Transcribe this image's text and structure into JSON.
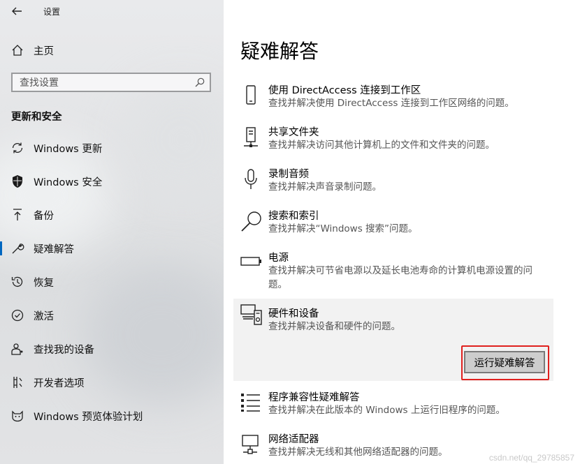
{
  "window": {
    "title": "设置"
  },
  "sidebar": {
    "home_label": "主页",
    "search_placeholder": "查找设置",
    "section_title": "更新和安全",
    "items": [
      {
        "label": "Windows 更新",
        "icon": "sync-icon"
      },
      {
        "label": "Windows 安全",
        "icon": "shield-icon"
      },
      {
        "label": "备份",
        "icon": "upload-icon"
      },
      {
        "label": "疑难解答",
        "icon": "wrench-icon",
        "selected": true
      },
      {
        "label": "恢复",
        "icon": "history-icon"
      },
      {
        "label": "激活",
        "icon": "check-circle-icon"
      },
      {
        "label": "查找我的设备",
        "icon": "person-pin-icon"
      },
      {
        "label": "开发者选项",
        "icon": "developer-icon"
      },
      {
        "label": "Windows 预览体验计划",
        "icon": "insider-cat-icon"
      }
    ]
  },
  "main": {
    "title": "疑难解答",
    "items": [
      {
        "title": "使用 DirectAccess 连接到工作区",
        "desc": "查找并解决使用 DirectAccess 连接到工作区网络的问题。",
        "icon": "phone-icon"
      },
      {
        "title": "共享文件夹",
        "desc": "查找并解决访问其他计算机上的文件和文件夹的问题。",
        "icon": "network-drive-icon"
      },
      {
        "title": "录制音频",
        "desc": "查找并解决声音录制问题。",
        "icon": "microphone-icon"
      },
      {
        "title": "搜索和索引",
        "desc": "查找并解决“Windows 搜索”问题。",
        "icon": "magnifier-icon"
      },
      {
        "title": "电源",
        "desc": "查找并解决可节省电源以及延长电池寿命的计算机电源设置的问题。",
        "icon": "battery-icon"
      },
      {
        "title": "硬件和设备",
        "desc": "查找并解决设备和硬件的问题。",
        "icon": "hardware-icon",
        "expanded": true
      },
      {
        "title": "程序兼容性疑难解答",
        "desc": "查找并解决在此版本的 Windows 上运行旧程序的问题。",
        "icon": "list-icon"
      },
      {
        "title": "网络适配器",
        "desc": "查找并解决无线和其他网络适配器的问题。",
        "icon": "network-adapter-icon"
      }
    ],
    "run_button_label": "运行疑难解答"
  },
  "watermark": "csdn.net/qq_29785857",
  "colors": {
    "accent": "#0067c0",
    "highlight_frame": "#e0201e"
  }
}
